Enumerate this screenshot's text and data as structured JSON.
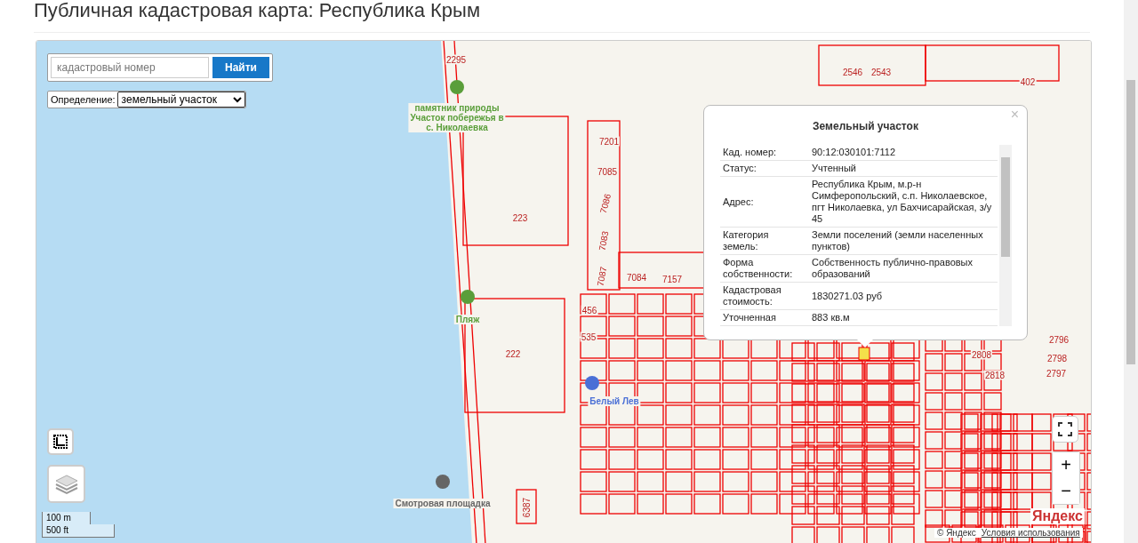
{
  "page_title": "Публичная кадастровая карта: Республика Крым",
  "search": {
    "placeholder": "кадастровый номер",
    "button": "Найти"
  },
  "definition": {
    "label": "Определение:",
    "value": "земельный участок"
  },
  "parcel_labels": [
    {
      "text": "2295"
    },
    {
      "text": "402"
    },
    {
      "text": "2546"
    },
    {
      "text": "2543"
    },
    {
      "text": "7201"
    },
    {
      "text": "7085"
    },
    {
      "text": "7086"
    },
    {
      "text": "7083"
    },
    {
      "text": "223"
    },
    {
      "text": "7087"
    },
    {
      "text": "7084"
    },
    {
      "text": "7157"
    },
    {
      "text": "222"
    },
    {
      "text": "456"
    },
    {
      "text": "535"
    },
    {
      "text": "2796"
    },
    {
      "text": "2808"
    },
    {
      "text": "2798"
    },
    {
      "text": "2818"
    },
    {
      "text": "2797"
    },
    {
      "text": "6387"
    }
  ],
  "places": [
    {
      "kind": "nature",
      "label": "памятник природы Участок побережья в с. Николаевка"
    },
    {
      "kind": "beach",
      "label": "Пляж"
    },
    {
      "kind": "sight",
      "label": "Белый Лев"
    },
    {
      "kind": "view",
      "label": "Смотровая площадка"
    }
  ],
  "popup": {
    "title": "Земельный участок",
    "close": "×",
    "rows": [
      {
        "label": "Кад. номер:",
        "value": "90:12:030101:7112"
      },
      {
        "label": "Статус:",
        "value": "Учтенный"
      },
      {
        "label": "Адрес:",
        "value": "Республика Крым, м.р-н Симферопольский, с.п. Николаевское, пгт Николаевка, ул Бахчисарайская, з/у 45"
      },
      {
        "label": "Категория земель:",
        "value": "Земли поселений (земли населенных пунктов)"
      },
      {
        "label": "Форма собственности:",
        "value": "Собственность публично-правовых образований"
      },
      {
        "label": "Кадастровая стоимость:",
        "value": "1830271.03 руб"
      },
      {
        "label": "Уточненная",
        "value": "883 кв.м"
      }
    ]
  },
  "scale": [
    "100 m",
    "500 ft"
  ],
  "zoom": {
    "in": "+",
    "out": "−"
  },
  "attribution": {
    "logo": "Яндекс",
    "copyright": "© Яндекс",
    "terms": "Условия использования"
  }
}
